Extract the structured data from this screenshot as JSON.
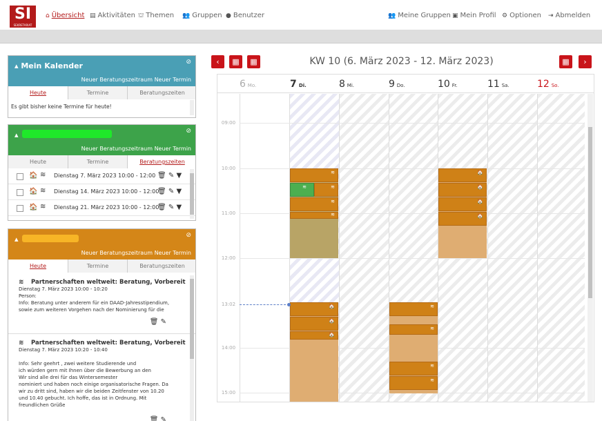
{
  "nav": {
    "logo": "SI",
    "logo_sub": "SEKRETARIAT",
    "left": [
      {
        "label": "Übersicht",
        "icon": "home-icon"
      },
      {
        "label": "Aktivitäten",
        "icon": "list-icon"
      },
      {
        "label": "Themen",
        "icon": "sitemap-icon"
      },
      {
        "label": "Gruppen",
        "icon": "users-icon"
      },
      {
        "label": "Benutzer",
        "icon": "user-icon"
      }
    ],
    "right": [
      {
        "label": "Meine Gruppen",
        "icon": "users-icon"
      },
      {
        "label": "Mein Profil",
        "icon": "id-card-icon"
      },
      {
        "label": "Optionen",
        "icon": "cogs-icon"
      },
      {
        "label": "Abmelden",
        "icon": "sign-out-icon"
      }
    ]
  },
  "panels": [
    {
      "title": "Mein Kalender",
      "color": "#4a9fb5",
      "actions": "Neuer Beratungszeitraum  Neuer Termin",
      "tabs": [
        "Heute",
        "Termine",
        "Beratungszeiten"
      ],
      "active_tab": 0,
      "message": "Es gibt bisher keine Termine für heute!"
    },
    {
      "title": "",
      "color": "#3da34a",
      "actions": "Neuer Beratungszeitraum  Neuer Termin",
      "tabs": [
        "Heute",
        "Termine",
        "Beratungszeiten"
      ],
      "active_tab": 2,
      "rows": [
        "Dienstag 7. März 2023 10:00 - 12:00",
        "Dienstag 14. März 2023 10:00 - 12:00",
        "Dienstag 21. März 2023 10:00 - 12:00"
      ]
    },
    {
      "title": "",
      "color": "#d48618",
      "actions": "Neuer Beratungszeitraum  Neuer Termin",
      "tabs": [
        "Heute",
        "Termine",
        "Beratungszeiten"
      ],
      "active_tab": 0,
      "entries": [
        {
          "title": "Partnerschaften weltweit: Beratung, Vorbereitung, Begleitung",
          "lines": [
            "Dienstag 7. März 2023 10:00 - 10:20",
            "Person:",
            "Info: Beratung unter anderem für ein DAAD-Jahresstipendium,",
            "sowie zum weiteren Vorgehen nach der Nominierung für die"
          ]
        },
        {
          "title": "Partnerschaften weltweit: Beratung, Vorbereitung, Begleitung",
          "lines": [
            "Dienstag 7. März 2023 10:20 - 10:40",
            "",
            "Info: Sehr geehrt                     , zwei weitere Studierende und",
            "ich würden gern mit Ihnen über die Bewerbung an den",
            "                                  Wir sind alle drei für das Wintersemester",
            "nominiert und haben noch einige organisatorische Fragen. Da",
            "wir zu dritt sind, haben wir die beiden Zeitfenster von 10.20",
            "und 10.40 gebucht. Ich hoffe, das ist in Ordnung. Mit",
            "freundlichen Grüße"
          ]
        }
      ]
    }
  ],
  "calendar": {
    "week_title": "KW 10 (6. März 2023 - 12. März 2023)",
    "days": [
      {
        "num": "6",
        "name": "Mo."
      },
      {
        "num": "7",
        "name": "Di."
      },
      {
        "num": "8",
        "name": "Mi."
      },
      {
        "num": "9",
        "name": "Do."
      },
      {
        "num": "10",
        "name": "Fr."
      },
      {
        "num": "11",
        "name": "Sa."
      },
      {
        "num": "12",
        "name": "So."
      }
    ],
    "hours": [
      "09:00",
      "10:00",
      "11:00",
      "12:00",
      "13:02",
      "14:00",
      "15:00"
    ],
    "colors": {
      "accent": "#c9141a",
      "event": "#cf8117",
      "green": "#4caf50",
      "now": "#5b7ec7"
    }
  }
}
